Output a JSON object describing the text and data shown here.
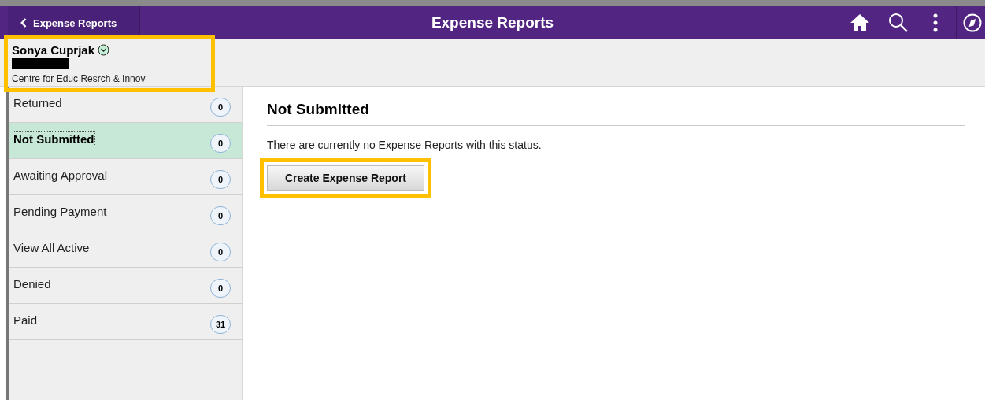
{
  "header": {
    "back_button": "Expense Reports",
    "title": "Expense Reports"
  },
  "profile": {
    "name": "Sonya Cuprjak",
    "redacted": true,
    "department": "Centre for Educ Resrch & Innov",
    "highlighted": true
  },
  "sidebar": {
    "items": [
      {
        "label": "Returned",
        "count": "0",
        "selected": false
      },
      {
        "label": "Not Submitted",
        "count": "0",
        "selected": true
      },
      {
        "label": "Awaiting Approval",
        "count": "0",
        "selected": false
      },
      {
        "label": "Pending Payment",
        "count": "0",
        "selected": false
      },
      {
        "label": "View All Active",
        "count": "0",
        "selected": false
      },
      {
        "label": "Denied",
        "count": "0",
        "selected": false
      },
      {
        "label": "Paid",
        "count": "31",
        "selected": false
      }
    ]
  },
  "main": {
    "heading": "Not Submitted",
    "message": "There are currently no Expense Reports with this status.",
    "button": {
      "label": "Create Expense Report",
      "highlighted": true
    }
  }
}
